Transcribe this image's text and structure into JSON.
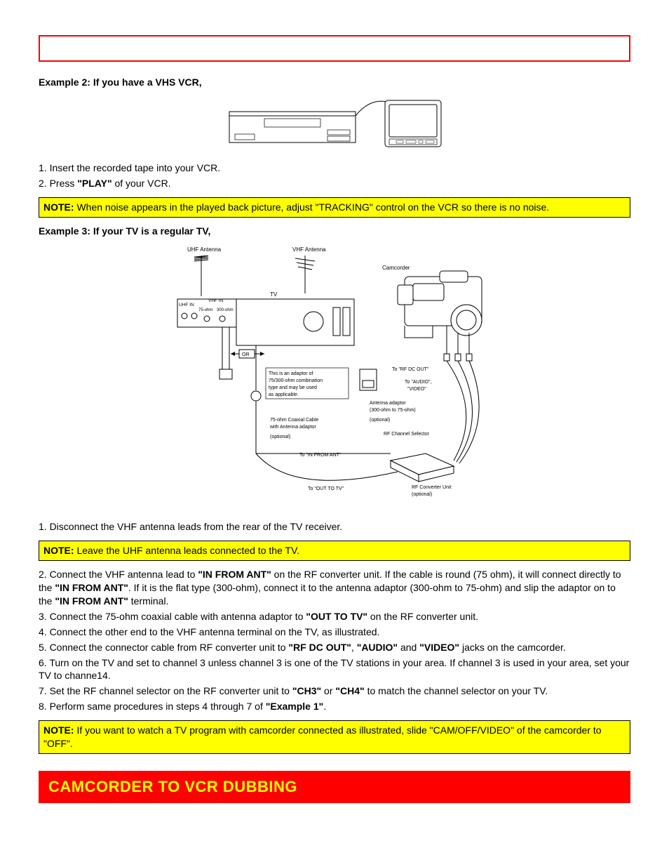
{
  "example2": {
    "heading": "Example 2: If you have a VHS VCR,",
    "step1": "1. Insert the recorded tape into your VCR.",
    "step2_pre": "2. Press ",
    "step2_bold": "\"PLAY\"",
    "step2_post": " of your VCR."
  },
  "note1": {
    "label": "NOTE:",
    "text": " When noise appears in the played back picture, adjust \"TRACKING\" control on the VCR so there is no noise."
  },
  "example3": {
    "heading": "Example 3: If your TV is a regular TV,",
    "step1": "1. Disconnect the VHF antenna leads from the rear of the TV receiver."
  },
  "note2": {
    "label": "NOTE:",
    "text": " Leave the UHF antenna leads connected to the TV."
  },
  "steps": {
    "s2a": "2. Connect the VHF antenna lead to ",
    "s2b": "\"IN FROM ANT\"",
    "s2c": " on the RF converter unit. If the cable is round (75 ohm), it will connect directly to the ",
    "s2d": "\"IN FROM ANT\"",
    "s2e": ". If it is the flat type (300-ohm), connect it to the antenna adaptor (300-ohm to 75-ohm) and slip the adaptor on to the ",
    "s2f": "\"IN FROM ANT\"",
    "s2g": " terminal.",
    "s3a": "3. Connect the 75-ohm coaxial cable with antenna adaptor to ",
    "s3b": "\"OUT TO TV\"",
    "s3c": " on the RF converter unit.",
    "s4": "4. Connect the other end to the VHF antenna terminal on the TV, as illustrated.",
    "s5a": "5. Connect the connector cable from RF converter unit to ",
    "s5b": "\"RF DC OUT\"",
    "s5c": ", ",
    "s5d": "\"AUDIO\"",
    "s5e": " and ",
    "s5f": "\"VIDEO\"",
    "s5g": " jacks on the camcorder.",
    "s6": "6. Turn on the TV and set to channel 3 unless channel 3 is one of the TV stations in your area. If channel 3 is used in your area, set your TV to channe14.",
    "s7a": "7. Set the RF channel selector on the RF converter unit to ",
    "s7b": "\"CH3\"",
    "s7c": " or ",
    "s7d": "\"CH4\"",
    "s7e": " to match the channel selector on your TV.",
    "s8a": "8. Perform same procedures in steps 4 through 7 of ",
    "s8b": "\"Example 1\"",
    "s8c": "."
  },
  "note3": {
    "label": "NOTE:",
    "text": " If you want to watch a TV program with camcorder connected as illustrated, slide \"CAM/OFF/VIDEO\" of the camcorder to \"OFF\"."
  },
  "banner": "CAMCORDER TO VCR DUBBING",
  "diagram": {
    "uhf_antenna": "UHF Antenna",
    "vhf_antenna": "VHF Antenna",
    "camcorder": "Camcorder",
    "tv": "TV",
    "uhf_in": "UHF IN",
    "vhf_in": "VHF IN",
    "ohm75": "75-ohm",
    "ohm300": "300-ohm",
    "or": "OR",
    "adaptor_note1": "This is an adaptor of",
    "adaptor_note2": "75/300-ohm combination",
    "adaptor_note3": "type and may be used",
    "adaptor_note4": "as applicable.",
    "to_rf_dc_out": "To \"RF DC OUT\"",
    "to_audio": "To \"AUDIO\",",
    "to_video": "\"VIDEO\"",
    "antenna_adaptor1": "Antenna adaptor",
    "antenna_adaptor2": "(300-ohm to 75-ohm)",
    "optional1": "(optional)",
    "coax1": "75-ohm Coaxial Cable",
    "coax2": "with Antenna adaptor",
    "optional2": "(optional)",
    "rf_sel": "RF Channel Selector",
    "to_in_from_ant": "To  \"IN FROM ANT\"",
    "to_out_to_tv": "To \"OUT TO TV\"",
    "rf_conv1": "RF Converter Unit",
    "rf_conv2": "(optional)"
  }
}
